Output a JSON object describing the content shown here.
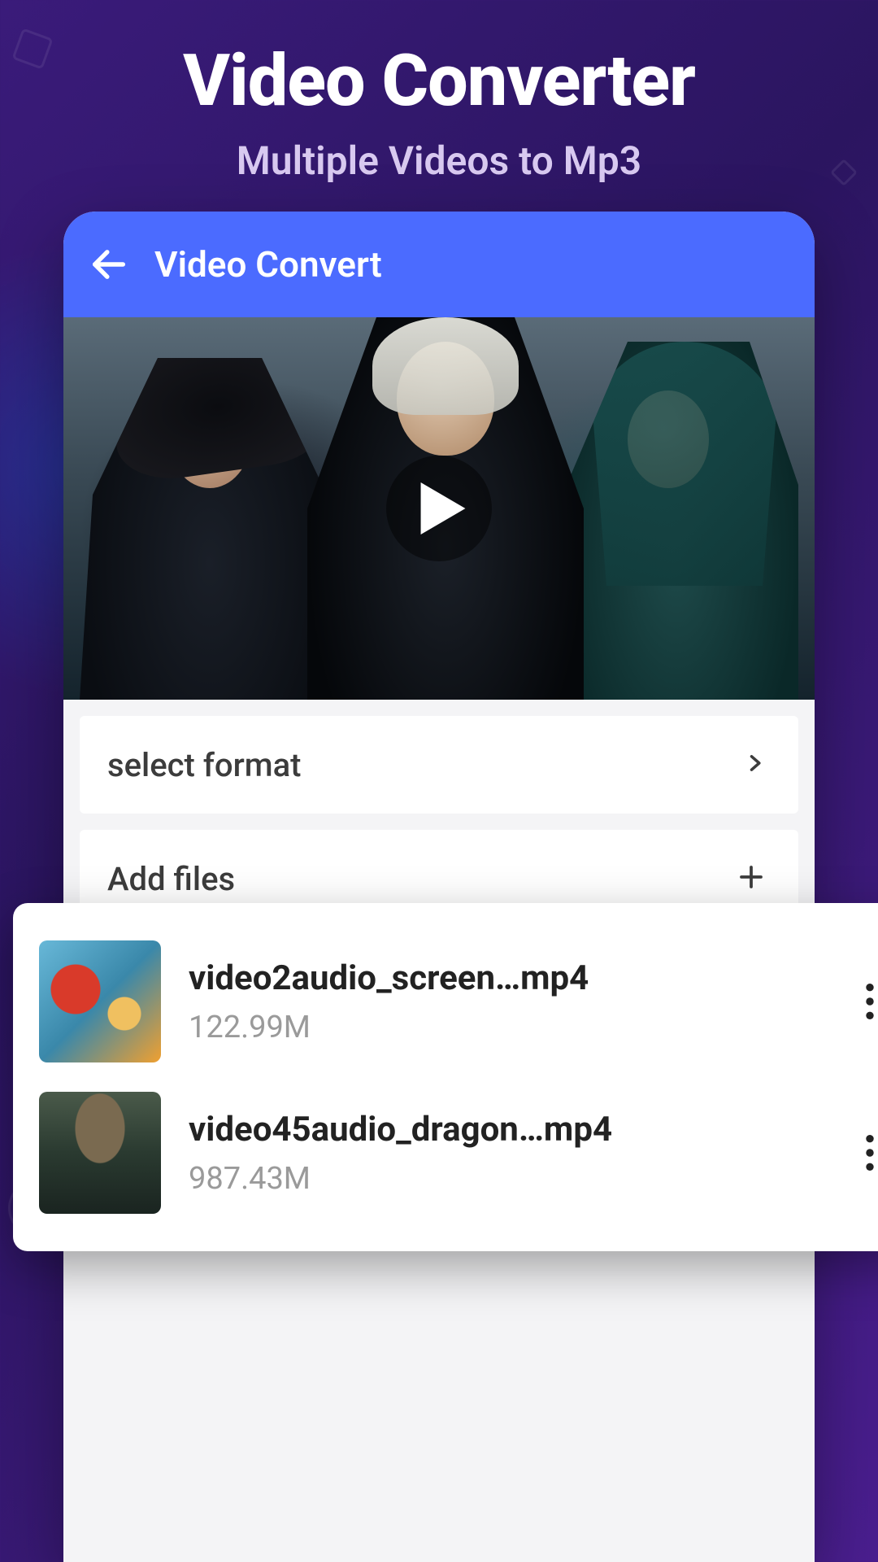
{
  "promo": {
    "title": "Video Converter",
    "subtitle": "Multiple Videos to Mp3"
  },
  "appbar": {
    "title": "Video Convert"
  },
  "options": {
    "select_format": "select format",
    "add_files": "Add files"
  },
  "files": [
    {
      "name": "video2audio_screen…mp4",
      "size": "122.99M"
    },
    {
      "name": "video45audio_dragon…mp4",
      "size": "987.43M"
    }
  ]
}
